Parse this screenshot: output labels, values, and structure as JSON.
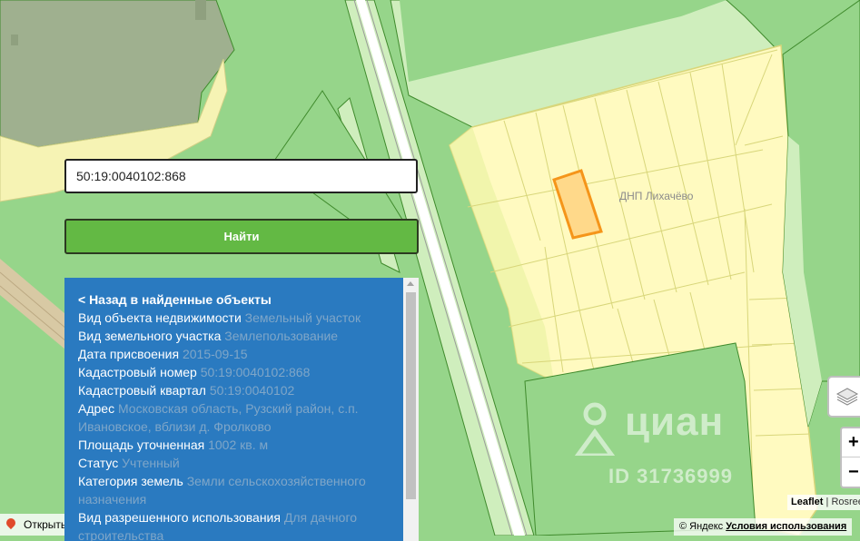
{
  "map": {
    "area_label": "ДНП Лихачёво",
    "watermark_brand": "циан",
    "watermark_id": "ID 31736999"
  },
  "search": {
    "value": "50:19:0040102:868",
    "button_label": "Найти"
  },
  "info": {
    "back_link": "< Назад в найденные объекты",
    "rows": [
      {
        "label": "Вид объекта недвижимости",
        "value": "Земельный участок"
      },
      {
        "label": "Вид земельного участка",
        "value": "Землепользование"
      },
      {
        "label": "Дата присвоения",
        "value": "2015-09-15"
      },
      {
        "label": "Кадастровый номер",
        "value": "50:19:0040102:868"
      },
      {
        "label": "Кадастровый квартал",
        "value": "50:19:0040102"
      },
      {
        "label": "Адрес",
        "value": "Московская область, Рузский район, с.п. Ивановское, вблизи д. Фролково"
      },
      {
        "label": "Площадь уточненная",
        "value": "1002 кв. м"
      },
      {
        "label": "Статус",
        "value": "Учтенный"
      },
      {
        "label": "Категория земель",
        "value": "Земли сельскохозяйственного назначения"
      },
      {
        "label": "Вид разрешенного использования",
        "value": "Для дачного строительства"
      }
    ]
  },
  "controls": {
    "zoom_in": "+",
    "zoom_out": "−",
    "layers_icon": "layers-icon"
  },
  "attribution": {
    "leaflet": "Leaflet",
    "separator": " | ",
    "rosreestr": "Rosreestr"
  },
  "footer": {
    "yandex": "© Яндекс",
    "terms": "Условия использования",
    "open_label": "Открыть"
  },
  "colors": {
    "map_background": "#96d58a",
    "light_green": "#cfeebd",
    "parcel_fill": "#fffac0",
    "parcel_stroke": "#d8d67a",
    "highlight_fill": "#ffd98a",
    "highlight_stroke": "#f5951a",
    "panel_bg": "#2a7ac0",
    "button_bg": "#63b944"
  }
}
